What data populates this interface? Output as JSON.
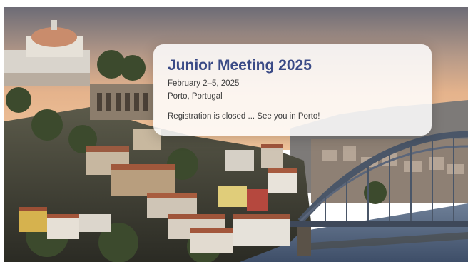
{
  "hero": {
    "background": "porto-cityscape-sunset-photo"
  },
  "event": {
    "title": "Junior Meeting 2025",
    "date": "February 2–5, 2025",
    "location": "Porto, Portugal",
    "message": "Registration is closed ... See you in Porto!"
  },
  "colors": {
    "title": "#3a4a86",
    "text": "#3d3d3d",
    "card": "#ffffff"
  }
}
